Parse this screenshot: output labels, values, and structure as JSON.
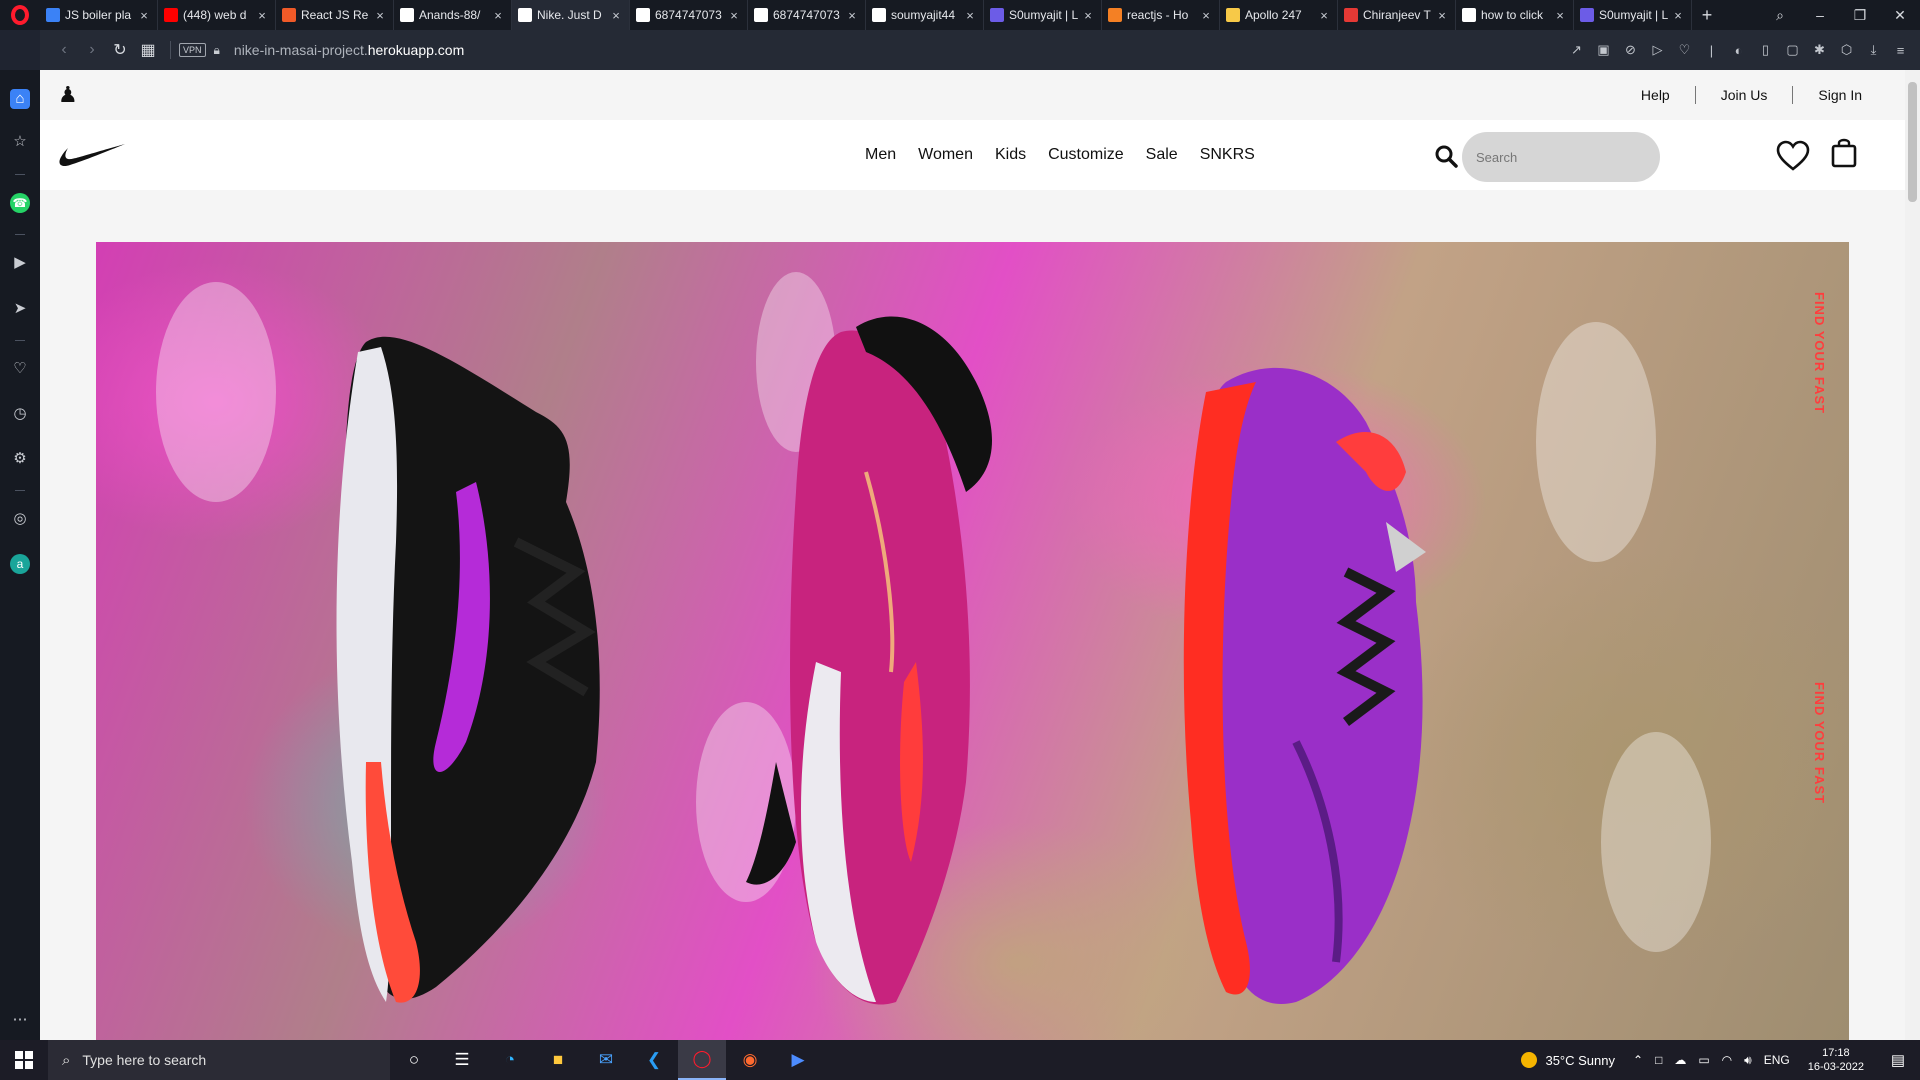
{
  "browser": {
    "tabs": [
      {
        "title": "JS boiler pla",
        "icon": "doc-icon",
        "color": "#3b82f6",
        "active": false
      },
      {
        "title": "(448) web d",
        "icon": "youtube-icon",
        "color": "#ff0000",
        "active": false
      },
      {
        "title": "React JS Re",
        "icon": "codepen-icon",
        "color": "#f05a28",
        "active": false
      },
      {
        "title": "Anands-88/",
        "icon": "github-icon",
        "color": "#ffffff",
        "active": false
      },
      {
        "title": "Nike. Just D",
        "icon": "nike-icon",
        "color": "#ffffff",
        "active": true
      },
      {
        "title": "6874747073",
        "icon": "globe-icon",
        "color": "#ffffff",
        "active": false
      },
      {
        "title": "6874747073",
        "icon": "globe-icon",
        "color": "#ffffff",
        "active": false
      },
      {
        "title": "soumyajit44",
        "icon": "github-icon",
        "color": "#ffffff",
        "active": false
      },
      {
        "title": "S0umyajit | L",
        "icon": "profile-icon",
        "color": "#6c5ce7",
        "active": false
      },
      {
        "title": "reactjs - Ho",
        "icon": "stackoverflow-icon",
        "color": "#f48024",
        "active": false
      },
      {
        "title": "Apollo 247",
        "icon": "apollo-icon",
        "color": "#f7c948",
        "active": false
      },
      {
        "title": "Chiranjeev T",
        "icon": "masai-icon",
        "color": "#e53935",
        "active": false
      },
      {
        "title": "how to click",
        "icon": "google-icon",
        "color": "#ffffff",
        "active": false
      },
      {
        "title": "S0umyajit | L",
        "icon": "profile-icon",
        "color": "#6c5ce7",
        "active": false
      }
    ],
    "new_tab": "+",
    "url_host_prefix": "nike-in-masai-project.",
    "url_host_main": "herokuapp.com",
    "vpn_label": "VPN"
  },
  "site": {
    "utility_links": [
      "Help",
      "Join Us",
      "Sign In"
    ],
    "menu": [
      "Men",
      "Women",
      "Kids",
      "Customize",
      "Sale",
      "SNKRS"
    ],
    "search_placeholder": "Search"
  },
  "hero": {
    "side_text_1": "FIND YOUR FAST",
    "side_text_2": "FIND YOUR FAST"
  },
  "taskbar": {
    "search_placeholder": "Type here to search",
    "weather": "35°C  Sunny",
    "language": "ENG",
    "time": "17:18",
    "date": "16-03-2022"
  }
}
